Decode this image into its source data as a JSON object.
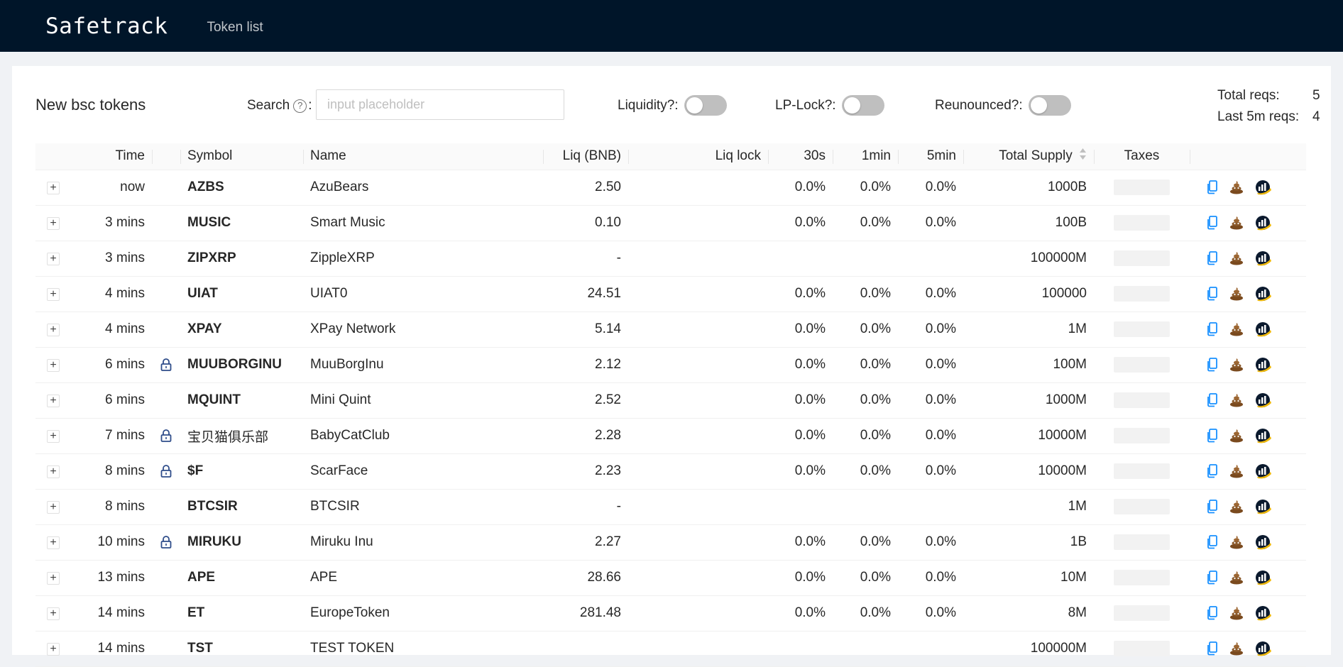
{
  "app": {
    "brand": "Safetrack",
    "nav": [
      "Token list"
    ]
  },
  "toolbar": {
    "title": "New bsc tokens",
    "search_label": "Search",
    "search_suffix": ":",
    "search_placeholder": "input placeholder",
    "filters": [
      {
        "label": "Liquidity?:",
        "on": false
      },
      {
        "label": "LP-Lock?:",
        "on": false
      },
      {
        "label": "Reunounced?:",
        "on": false
      }
    ],
    "stats": [
      {
        "label": "Total reqs:",
        "value": "5"
      },
      {
        "label": "Last 5m reqs:",
        "value": "4"
      }
    ]
  },
  "columns": [
    "Time",
    "",
    "Symbol",
    "Name",
    "Liq (BNB)",
    "Liq lock",
    "30s",
    "1min",
    "5min",
    "Total Supply",
    "Taxes",
    ""
  ],
  "rows": [
    {
      "time": "now",
      "lock": false,
      "symbol": "AZBS",
      "name": "AzuBears",
      "liq": "2.50",
      "liqlock": "",
      "s30": "0.0%",
      "m1": "0.0%",
      "m5": "0.0%",
      "supply": "1000B"
    },
    {
      "time": "3 mins",
      "lock": false,
      "symbol": "MUSIC",
      "name": "Smart Music",
      "liq": "0.10",
      "liqlock": "",
      "s30": "0.0%",
      "m1": "0.0%",
      "m5": "0.0%",
      "supply": "100B"
    },
    {
      "time": "3 mins",
      "lock": false,
      "symbol": "ZIPXRP",
      "name": "ZippleXRP",
      "liq": "-",
      "liqlock": "",
      "s30": "",
      "m1": "",
      "m5": "",
      "supply": "100000M"
    },
    {
      "time": "4 mins",
      "lock": false,
      "symbol": "UIAT",
      "name": "UIAT0",
      "liq": "24.51",
      "liqlock": "",
      "s30": "0.0%",
      "m1": "0.0%",
      "m5": "0.0%",
      "supply": "100000"
    },
    {
      "time": "4 mins",
      "lock": false,
      "symbol": "XPAY",
      "name": "XPay Network",
      "liq": "5.14",
      "liqlock": "",
      "s30": "0.0%",
      "m1": "0.0%",
      "m5": "0.0%",
      "supply": "1M"
    },
    {
      "time": "6 mins",
      "lock": true,
      "symbol": "MUUBORGINU",
      "name": "MuuBorgInu",
      "liq": "2.12",
      "liqlock": "",
      "s30": "0.0%",
      "m1": "0.0%",
      "m5": "0.0%",
      "supply": "100M"
    },
    {
      "time": "6 mins",
      "lock": false,
      "symbol": "MQUINT",
      "name": "Mini Quint",
      "liq": "2.52",
      "liqlock": "",
      "s30": "0.0%",
      "m1": "0.0%",
      "m5": "0.0%",
      "supply": "1000M"
    },
    {
      "time": "7 mins",
      "lock": true,
      "symbol": "宝贝猫俱乐部",
      "cjk": true,
      "name": "BabyCatClub",
      "liq": "2.28",
      "liqlock": "",
      "s30": "0.0%",
      "m1": "0.0%",
      "m5": "0.0%",
      "supply": "10000M"
    },
    {
      "time": "8 mins",
      "lock": true,
      "symbol": "$F",
      "name": "ScarFace",
      "liq": "2.23",
      "liqlock": "",
      "s30": "0.0%",
      "m1": "0.0%",
      "m5": "0.0%",
      "supply": "10000M"
    },
    {
      "time": "8 mins",
      "lock": false,
      "symbol": "BTCSIR",
      "name": "BTCSIR",
      "liq": "-",
      "liqlock": "",
      "s30": "",
      "m1": "",
      "m5": "",
      "supply": "1M"
    },
    {
      "time": "10 mins",
      "lock": true,
      "symbol": "MIRUKU",
      "name": "Miruku Inu",
      "liq": "2.27",
      "liqlock": "",
      "s30": "0.0%",
      "m1": "0.0%",
      "m5": "0.0%",
      "supply": "1B"
    },
    {
      "time": "13 mins",
      "lock": false,
      "symbol": "APE",
      "name": "APE",
      "liq": "28.66",
      "liqlock": "",
      "s30": "0.0%",
      "m1": "0.0%",
      "m5": "0.0%",
      "supply": "10M"
    },
    {
      "time": "14 mins",
      "lock": false,
      "symbol": "ET",
      "name": "EuropeToken",
      "liq": "281.48",
      "liqlock": "",
      "s30": "0.0%",
      "m1": "0.0%",
      "m5": "0.0%",
      "supply": "8M"
    },
    {
      "time": "14 mins",
      "lock": false,
      "symbol": "TST",
      "name": "TEST TOKEN",
      "liq": "",
      "liqlock": "",
      "s30": "",
      "m1": "",
      "m5": "",
      "supply": "100000M"
    }
  ],
  "icons": {
    "copy": "copy-icon",
    "poo": "poocoin-icon",
    "chart": "dextools-chart-icon",
    "lock": "lock-icon",
    "help": "question-circle-icon",
    "sort": "sort-icon",
    "expand": "plus-icon"
  },
  "colors": {
    "header_bg": "#001529",
    "copy_icon": "#1890ff",
    "poo_icon": "#8b5a2b",
    "chart_icon": "#f0b90b",
    "lock_icon": "#2f4d8a"
  }
}
